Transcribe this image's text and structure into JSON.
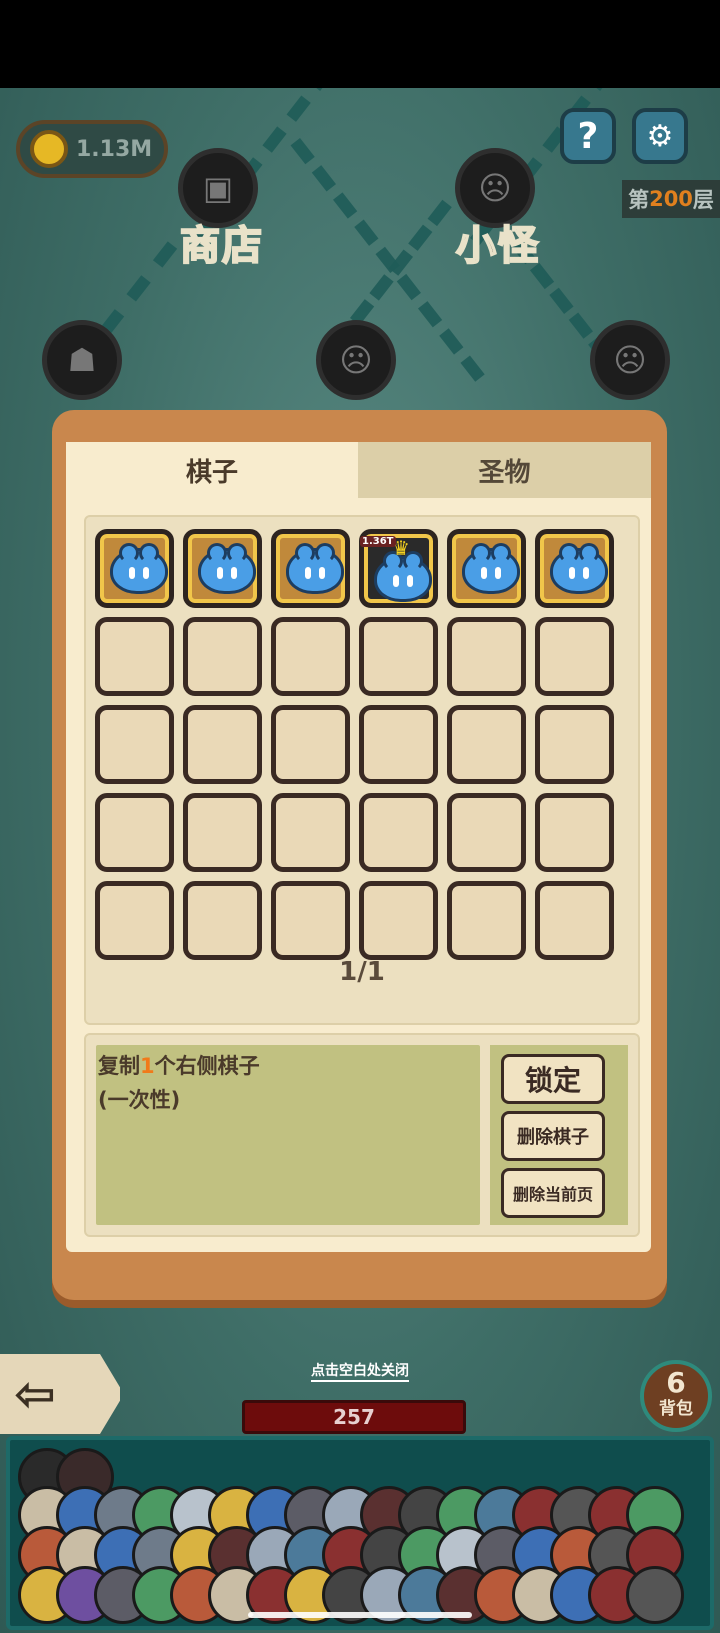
{
  "header": {
    "coins": "1.13M",
    "help_label": "?",
    "settings_label": "⚙",
    "floor_prefix": "第",
    "floor_number": "200",
    "floor_suffix": "层"
  },
  "map": {
    "node_shop_label": "商店",
    "node_minion_label": "小怪"
  },
  "panel": {
    "tab_pieces": "棋子",
    "tab_relics": "圣物",
    "first_row_pieces": [
      "slime",
      "slime",
      "slime",
      "crowned-slime",
      "slime",
      "slime"
    ],
    "crowned_piece_value": "1.36T",
    "page_indicator": "1/1",
    "description_prefix": "复制",
    "description_count": "1",
    "description_suffix": "个右侧棋子",
    "description_line2": "(一次性)",
    "btn_lock": "锁定",
    "btn_delete_piece": "删除棋子",
    "btn_delete_page": "删除当前页"
  },
  "footer": {
    "close_hint": "点击空白处关闭",
    "hp_value": "257",
    "back_icon": "⇦",
    "bag_count": "6",
    "bag_label": "背包"
  },
  "colors": {
    "slime": "#4a9ee6",
    "highlight": "#f07a1a",
    "panel_frame": "#c9874d",
    "hp_bar": "#6d0c0c"
  }
}
